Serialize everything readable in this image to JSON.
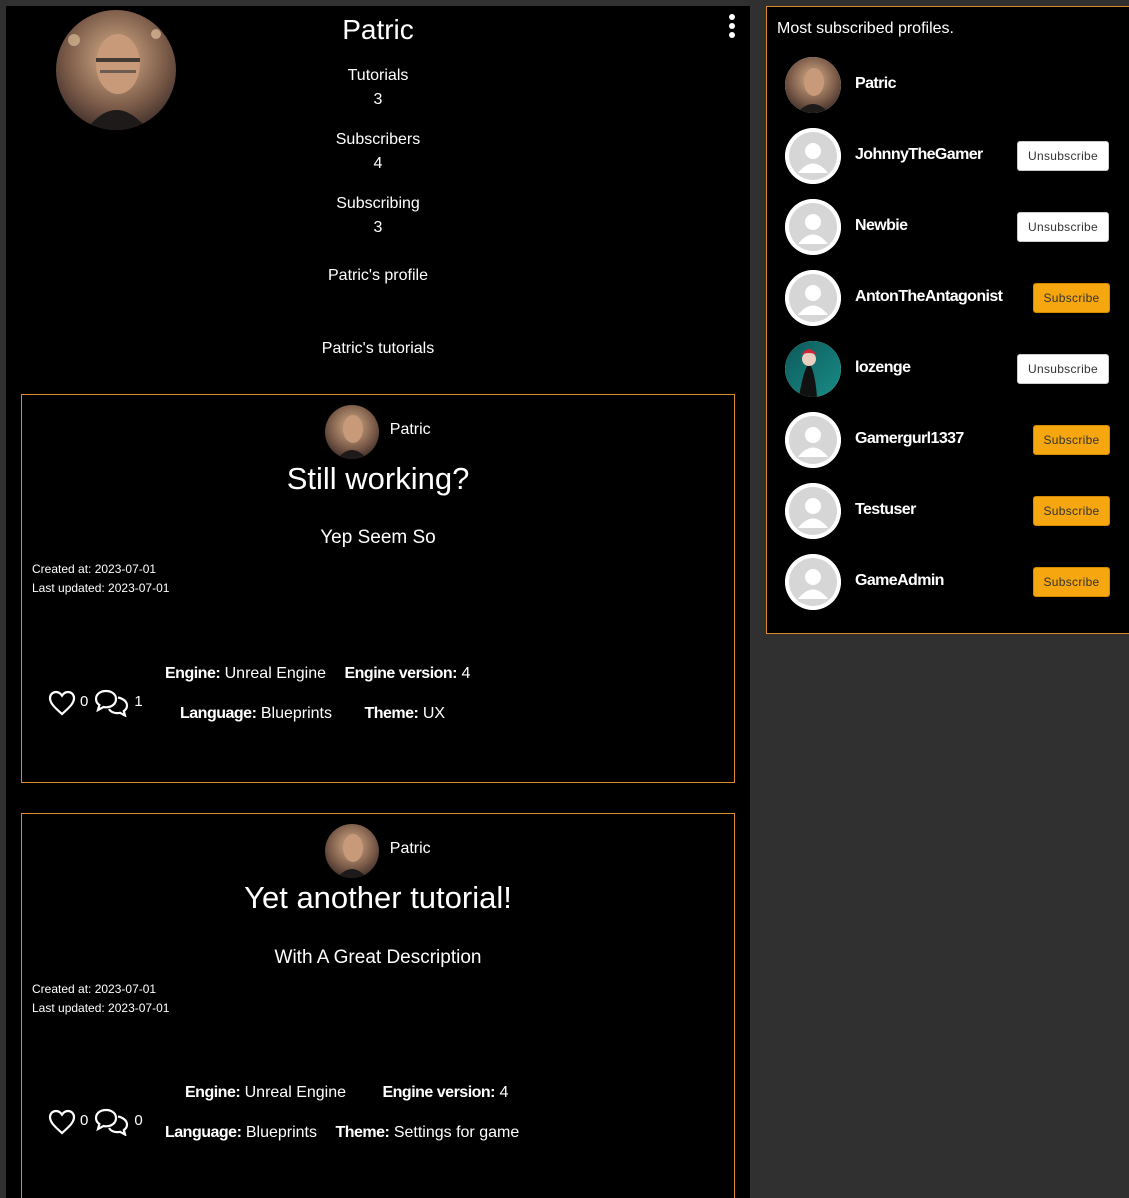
{
  "profile": {
    "name": "Patric",
    "stats": [
      {
        "label": "Tutorials",
        "value": "3"
      },
      {
        "label": "Subscribers",
        "value": "4"
      },
      {
        "label": "Subscribing",
        "value": "3"
      }
    ],
    "profile_link": "Patric's profile",
    "tutorials_link": "Patric's tutorials"
  },
  "tutorials": [
    {
      "author": "Patric",
      "title": "Still working?",
      "description": "Yep Seem So",
      "created": "Created at: 2023-07-01",
      "updated": "Last updated: 2023-07-01",
      "likes": "0",
      "comments": "1",
      "engine_label": "Engine:",
      "engine": "Unreal Engine",
      "version_label": "Engine version:",
      "version": "4",
      "language_label": "Language:",
      "language": "Blueprints",
      "theme_label": "Theme:",
      "theme": "UX"
    },
    {
      "author": "Patric",
      "title": "Yet another tutorial!",
      "description": "With A Great Description",
      "created": "Created at: 2023-07-01",
      "updated": "Last updated: 2023-07-01",
      "likes": "0",
      "comments": "0",
      "engine_label": "Engine:",
      "engine": "Unreal Engine",
      "version_label": "Engine version:",
      "version": "4",
      "language_label": "Language:",
      "language": "Blueprints",
      "theme_label": "Theme:",
      "theme": "Settings for game"
    }
  ],
  "sidebar": {
    "title": "Most subscribed profiles.",
    "profiles": [
      {
        "name": "Patric",
        "button": ""
      },
      {
        "name": "JohnnyTheGamer",
        "button": "Unsubscribe"
      },
      {
        "name": "Newbie",
        "button": "Unsubscribe"
      },
      {
        "name": "AntonTheAntagonist",
        "button": "Subscribe"
      },
      {
        "name": "lozenge",
        "button": "Unsubscribe"
      },
      {
        "name": "Gamergurl1337",
        "button": "Subscribe"
      },
      {
        "name": "Testuser",
        "button": "Subscribe"
      },
      {
        "name": "GameAdmin",
        "button": "Subscribe"
      }
    ]
  },
  "colors": {
    "accent_border": "#d98a2a",
    "subscribe_button": "#f6a60e",
    "page_background": "#303030",
    "panel_background": "#000000"
  }
}
